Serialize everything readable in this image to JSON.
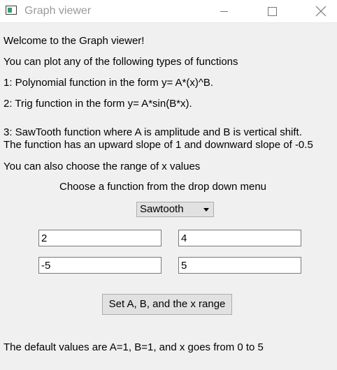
{
  "window": {
    "title": "Graph viewer",
    "icon": "app-window-icon",
    "controls": [
      "minimize-icon",
      "maximize-icon",
      "close-icon"
    ]
  },
  "content": {
    "welcome": "Welcome to the Graph viewer!",
    "intro": "You can plot any of the following types of functions",
    "option1": "1: Polynomial function in the form y= A*(x)^B.",
    "option2": "2: Trig function in the form y= A*sin(B*x).",
    "option3_line1": "3: SawTooth function where A is amplitude and B is vertical shift.",
    "option3_line2": "The function has an upward slope of 1 and downward slope of -0.5",
    "range_note": "You can also choose the range of x values",
    "choose_label": "Choose a function from the drop down menu",
    "default_note": "The default values are A=1, B=1, and x goes from 0 to 5"
  },
  "form": {
    "function_select": {
      "selected": "Sawtooth"
    },
    "input_a": "2",
    "input_b": "4",
    "input_x_min": "-5",
    "input_x_max": "5",
    "set_button_label": "Set A, B, and the x range"
  }
}
